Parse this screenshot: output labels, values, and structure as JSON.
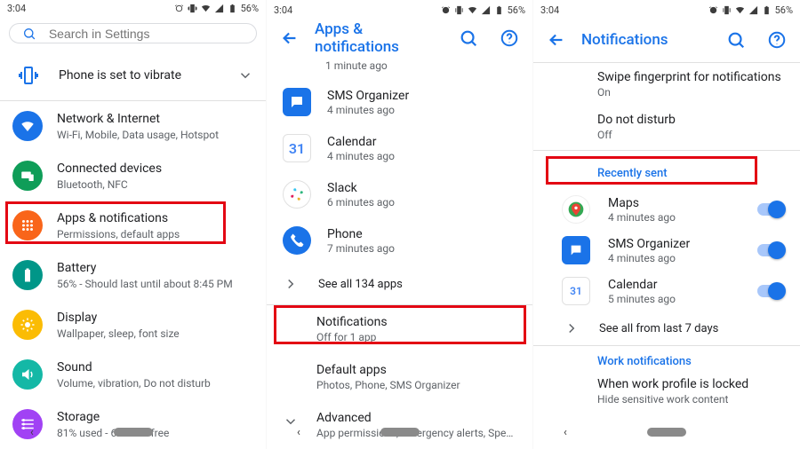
{
  "status": {
    "time": "3:04",
    "battery": "56%"
  },
  "pane1": {
    "search_placeholder": "Search in Settings",
    "vibrate": {
      "title": "Phone is set to vibrate"
    },
    "items": [
      {
        "title": "Network & Internet",
        "sub": "Wi-Fi, Mobile, Data usage, Hotspot",
        "color": "#1a73e8"
      },
      {
        "title": "Connected devices",
        "sub": "Bluetooth, NFC",
        "color": "#0f9d58"
      },
      {
        "title": "Apps & notifications",
        "sub": "Permissions, default apps",
        "color": "#f9651a"
      },
      {
        "title": "Battery",
        "sub": "56% - Should last until about 8:45 PM",
        "color": "#009688"
      },
      {
        "title": "Display",
        "sub": "Wallpaper, sleep, font size",
        "color": "#fbbc04"
      },
      {
        "title": "Sound",
        "sub": "Volume, vibration, Do not disturb",
        "color": "#14b8a6"
      },
      {
        "title": "Storage",
        "sub": "81% used - 6.19 GB free",
        "color": "#a142f4"
      }
    ]
  },
  "pane2": {
    "header": "Apps & notifications",
    "top_sub": "1 minute ago",
    "apps": [
      {
        "title": "SMS Organizer",
        "sub": "4 minutes ago",
        "color": "#1a73e8"
      },
      {
        "title": "Calendar",
        "sub": "4 minutes ago",
        "color": "#ffffff"
      },
      {
        "title": "Slack",
        "sub": "6 minutes ago",
        "color": "#ffffff"
      },
      {
        "title": "Phone",
        "sub": "7 minutes ago",
        "color": "#1a73e8"
      }
    ],
    "see_all": "See all 134 apps",
    "rows": [
      {
        "title": "Notifications",
        "sub": "Off for 1 app"
      },
      {
        "title": "Default apps",
        "sub": "Photos, Phone, SMS Organizer"
      },
      {
        "title": "Advanced",
        "sub": "App permissions, Emergency alerts, Special app a.."
      }
    ]
  },
  "pane3": {
    "header": "Notifications",
    "top": [
      {
        "title": "Swipe fingerprint for notifications",
        "sub": "On"
      },
      {
        "title": "Do not disturb",
        "sub": "Off"
      }
    ],
    "section1": "Recently sent",
    "recent": [
      {
        "title": "Maps",
        "sub": "4 minutes ago"
      },
      {
        "title": "SMS Organizer",
        "sub": "4 minutes ago"
      },
      {
        "title": "Calendar",
        "sub": "5 minutes ago"
      }
    ],
    "see_all": "See all from last 7 days",
    "section2": "Work notifications",
    "work": {
      "title": "When work profile is locked",
      "sub": "Hide sensitive work content"
    }
  }
}
